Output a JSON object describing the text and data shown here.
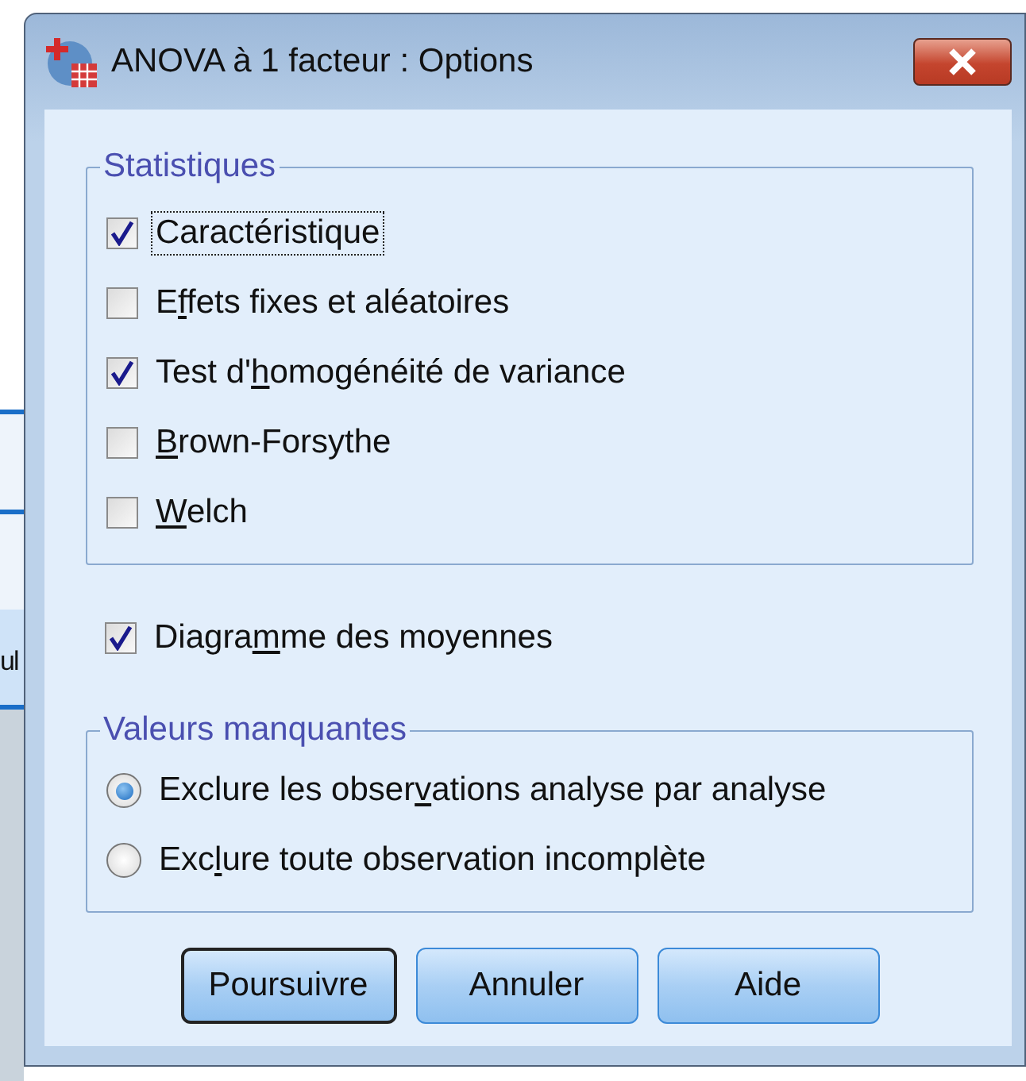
{
  "background": {
    "fragment": "ul"
  },
  "window": {
    "title": "ANOVA à 1 facteur : Options"
  },
  "statistics": {
    "title": "Statistiques",
    "items": [
      {
        "before": "Caractéristique",
        "checked": true,
        "focused": true
      },
      {
        "before": "E",
        "key": "f",
        "after": "fets fixes et aléatoires",
        "checked": false,
        "focused": false
      },
      {
        "before": "Test d'",
        "key": "h",
        "after": "omogénéité de variance",
        "checked": true,
        "focused": false
      },
      {
        "key": "B",
        "after": "rown-Forsythe",
        "checked": false,
        "focused": false
      },
      {
        "key": "W",
        "after": "elch",
        "checked": false,
        "focused": false
      }
    ]
  },
  "means_plot": {
    "before": "Diagra",
    "key": "m",
    "after": "me des moyennes",
    "checked": true
  },
  "missing_values": {
    "title": "Valeurs manquantes",
    "options": [
      {
        "before": "Exclure les obser",
        "key": "v",
        "after": "ations analyse par analyse",
        "selected": true
      },
      {
        "before": "Exc",
        "key": "l",
        "after": "ure toute observation incomplète",
        "selected": false
      }
    ]
  },
  "buttons": [
    {
      "label": "Poursuivre",
      "default": true
    },
    {
      "label": "Annuler",
      "default": false
    },
    {
      "label": "Aide",
      "default": false
    }
  ]
}
